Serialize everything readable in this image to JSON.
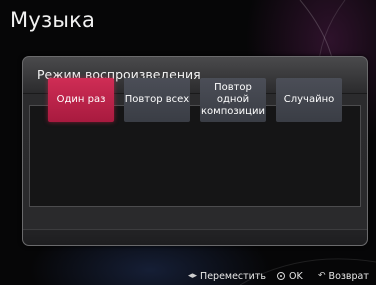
{
  "app": {
    "title": "Музыка"
  },
  "dialog": {
    "title": "Режим воспроизведения",
    "options": [
      {
        "label": "Один раз",
        "selected": true
      },
      {
        "label": "Повтор всех",
        "selected": false
      },
      {
        "label": "Повтор\nодной\nкомпозиции",
        "selected": false
      },
      {
        "label": "Случайно",
        "selected": false
      }
    ]
  },
  "footer": {
    "move": {
      "icon": "left-right-arrows-icon",
      "label": "Переместить"
    },
    "ok": {
      "icon": "ok-button-icon",
      "label": "OK"
    },
    "back": {
      "icon": "return-arrow-icon",
      "label": "Возврат"
    }
  },
  "colors": {
    "accent": "#c8234c",
    "button": "#434650",
    "dialog": "#2b2b2d"
  }
}
